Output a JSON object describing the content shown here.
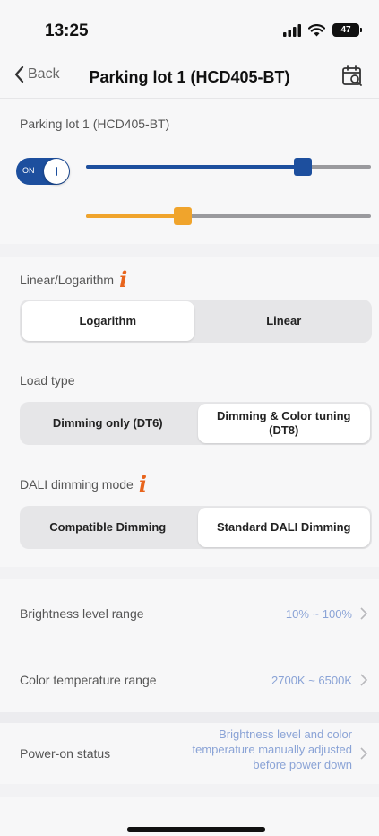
{
  "status_bar": {
    "time": "13:25",
    "battery": "47"
  },
  "nav": {
    "back_label": "Back",
    "title": "Parking lot 1 (HCD405-BT)"
  },
  "lamp": {
    "name": "Parking lot 1 (HCD405-BT)",
    "toggle_label": "ON",
    "power_on": true,
    "brightness_level": 0.76,
    "color_temperature_level": 0.34
  },
  "settings": {
    "curve": {
      "label": "Linear/Logarithm",
      "options": [
        "Logarithm",
        "Linear"
      ],
      "selected": "Logarithm"
    },
    "load_type": {
      "label": "Load type",
      "options": [
        "Dimming only (DT6)",
        "Dimming & Color tuning (DT8)"
      ],
      "selected": "Dimming & Color tuning (DT8)"
    },
    "dali_mode": {
      "label": "DALI dimming mode",
      "options": [
        "Compatible Dimming",
        "Standard DALI Dimming"
      ],
      "selected": "Standard DALI Dimming"
    }
  },
  "list": {
    "brightness_range": {
      "label": "Brightness level range",
      "value": "10% ~ 100%"
    },
    "cct_range": {
      "label": "Color temperature range",
      "value": "2700K ~ 6500K"
    },
    "power_on_status": {
      "label": "Power-on status",
      "value": "Brightness level and color temperature manually adjusted before power down"
    }
  },
  "colors": {
    "accent_blue": "#1d4f9e",
    "accent_orange": "#f0a42c",
    "info_icon": "#e8641c",
    "value_text": "#8aa3d6"
  },
  "icons": [
    "signal-icon",
    "wifi-icon",
    "battery-icon",
    "chevron-left-icon",
    "calendar-search-icon",
    "info-icon",
    "chevron-right-icon"
  ]
}
